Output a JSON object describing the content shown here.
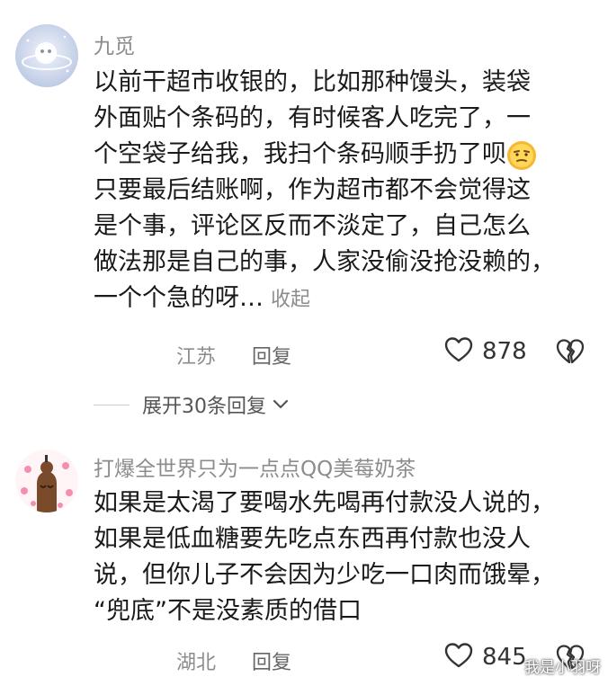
{
  "comments": [
    {
      "username": "九觅",
      "lines": [
        "以前干超市收银的，比如那种馒头，装袋",
        "外面贴个条码的，有时候客人吃完了，一",
        "个空袋子给我，我扫个条码顺手扔了呗",
        "只要最后结账啊，作为超市都不会觉得这",
        "是个事，评论区反而不淡定了，自己怎么",
        "做法那是自己的事，人家没偷没抢没赖的，",
        "一个个急的呀…"
      ],
      "collapse_label": "收起",
      "location": "江苏",
      "reply_label": "回复",
      "likes": "878",
      "expand_label": "展开30条回复"
    },
    {
      "username": "打爆全世界只为一点点QQ美莓奶茶",
      "lines": [
        "如果是太渴了要喝水先喝再付款没人说的，",
        "如果是低血糖要先吃点东西再付款也没人",
        "说，但你儿子不会因为少吃一口肉而饿晕，",
        "“兜底”不是没素质的借口"
      ],
      "location": "湖北",
      "reply_label": "回复",
      "likes": "845"
    }
  ],
  "watermark": "我是小羽呀",
  "icons": {
    "like": "heart-outline-icon",
    "dislike": "broken-heart-icon",
    "expand": "chevron-down-icon",
    "emoji": "sly-face-emoji-icon"
  },
  "colors": {
    "text": "#1a1a1a",
    "meta": "#8c8c8c",
    "background": "#ffffff"
  }
}
